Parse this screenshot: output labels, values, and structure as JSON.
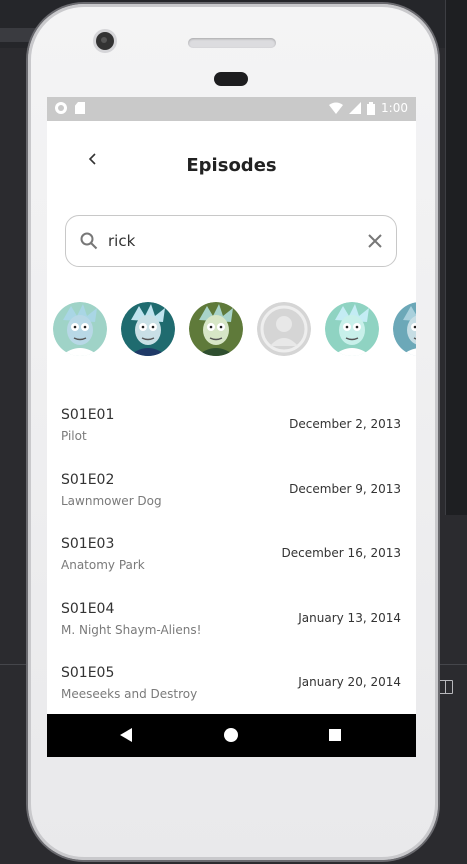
{
  "status_bar": {
    "time": "1:00"
  },
  "header": {
    "title": "Episodes",
    "back_icon": "chevron-left-icon"
  },
  "search": {
    "value": "rick",
    "placeholder": "",
    "search_icon": "search-icon",
    "clear_icon": "close-icon"
  },
  "characters": [
    {
      "name": "avatar-rick-1",
      "bg": "#9fd3c7",
      "face": "#b8d8e6",
      "hair": "#a9d6e5",
      "shirt": "#ffffff"
    },
    {
      "name": "avatar-rick-2",
      "bg": "#1f6b6f",
      "face": "#c9e0e6",
      "hair": "#bfe3ee",
      "shirt": "#1f3a68"
    },
    {
      "name": "avatar-rick-3",
      "bg": "#5f7a3a",
      "face": "#d7e6c6",
      "hair": "#a8d3c9",
      "shirt": "#2f4f2f"
    },
    {
      "name": "avatar-placeholder",
      "bg": "#d5d5d5",
      "face": "#e8e8e8",
      "hair": "#bdbdbd",
      "shirt": "#bdbdbd"
    },
    {
      "name": "avatar-rick-4",
      "bg": "#8fd3c2",
      "face": "#c8f0ea",
      "hair": "#c4ecf4",
      "shirt": "#ffffff"
    },
    {
      "name": "avatar-rick-5",
      "bg": "#6ca8b8",
      "face": "#c6dde4",
      "hair": "#a9d0dc",
      "shirt": "#ffffff"
    }
  ],
  "episodes": [
    {
      "code": "S01E01",
      "name": "Pilot",
      "date": "December 2, 2013"
    },
    {
      "code": "S01E02",
      "name": "Lawnmower Dog",
      "date": "December 9, 2013"
    },
    {
      "code": "S01E03",
      "name": "Anatomy Park",
      "date": "December 16, 2013"
    },
    {
      "code": "S01E04",
      "name": "M. Night Shaym-Aliens!",
      "date": "January 13, 2014"
    },
    {
      "code": "S01E05",
      "name": "Meeseeks and Destroy",
      "date": "January 20, 2014"
    }
  ],
  "nav_bar": {
    "back_icon": "nav-back-icon",
    "home_icon": "nav-home-icon",
    "recents_icon": "nav-recents-icon"
  }
}
